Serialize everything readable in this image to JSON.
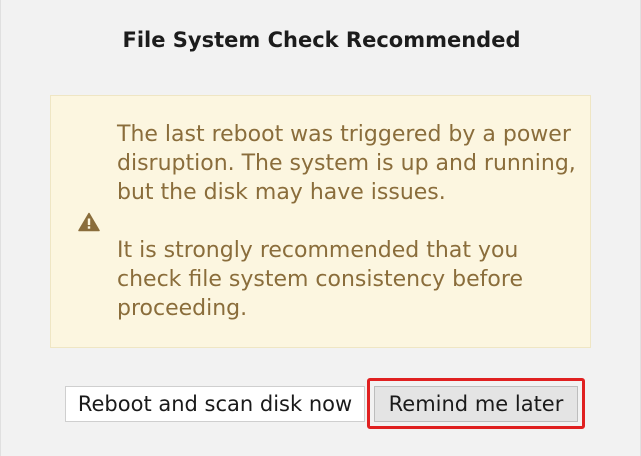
{
  "dialog": {
    "title": "File System Check Recommended",
    "notice": {
      "icon": "warning-triangle-icon",
      "paragraph_1": "The last reboot was triggered by a power disruption. The system is up and running, but the disk may have issues.",
      "paragraph_2": "It is strongly recommended that you check file system consistency before proceeding."
    },
    "buttons": {
      "reboot_label": "Reboot and scan disk now",
      "remind_label": "Remind me later"
    }
  },
  "colors": {
    "notice_background": "#fcf6e0",
    "notice_text": "#8a6d3b",
    "highlight": "#e02020"
  }
}
